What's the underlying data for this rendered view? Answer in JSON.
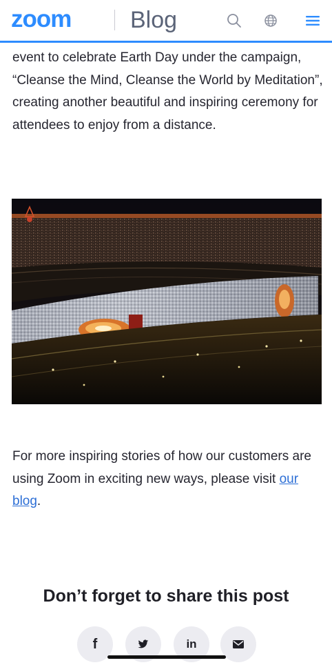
{
  "header": {
    "logo": "zoom",
    "section_title": "Blog",
    "icons": [
      "search-icon",
      "globe-icon",
      "menu-icon"
    ],
    "accent_color": "#2d8cff"
  },
  "article": {
    "paragraph_1": "event to celebrate Earth Day under the campaign, “Cleanse the Mind, Cleanse the World by Meditation”, creating another beautiful and inspiring ceremony for attendees to enjoy from a distance.",
    "paragraph_2_text": "For more inspiring stories of how our customers are using Zoom in exciting new ways, please visit ",
    "paragraph_2_link": "our blog",
    "paragraph_2_end": "."
  },
  "share": {
    "heading": "Don’t forget to share this post",
    "facebook_label": "f",
    "linkedin_label": "in",
    "icons": [
      "facebook-icon",
      "twitter-icon",
      "linkedin-icon",
      "email-icon"
    ]
  }
}
